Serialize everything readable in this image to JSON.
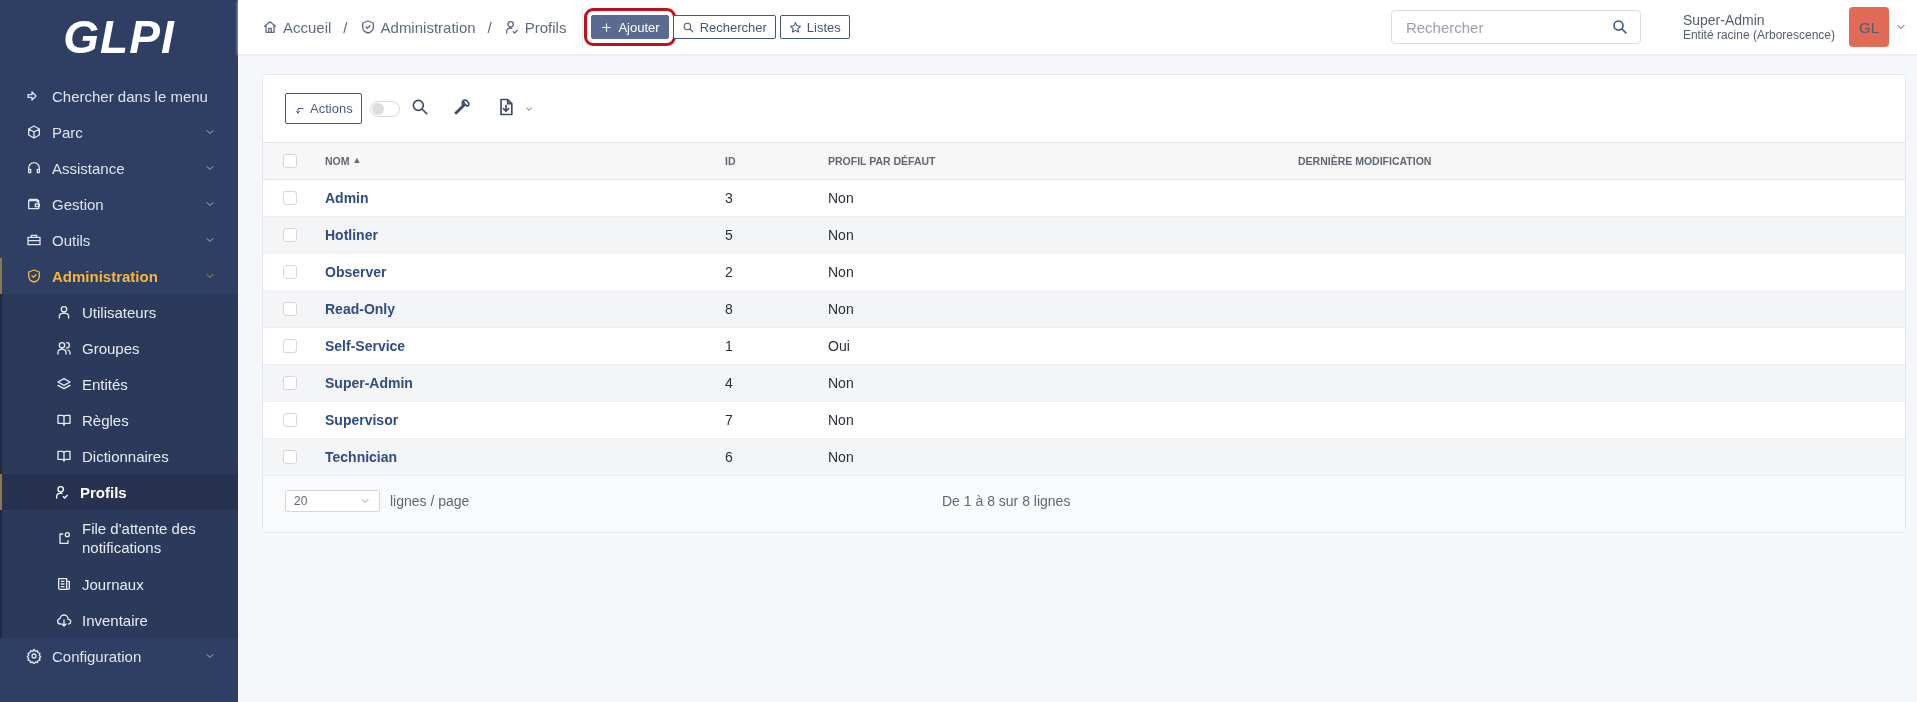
{
  "sidebar": {
    "logo": "GLPI",
    "search_item": "Chercher dans le menu",
    "items": [
      {
        "label": "Parc",
        "selected": false
      },
      {
        "label": "Assistance",
        "selected": false
      },
      {
        "label": "Gestion",
        "selected": false
      },
      {
        "label": "Outils",
        "selected": false
      },
      {
        "label": "Administration",
        "selected": true,
        "children": [
          {
            "label": "Utilisateurs",
            "selected": false
          },
          {
            "label": "Groupes",
            "selected": false
          },
          {
            "label": "Entités",
            "selected": false
          },
          {
            "label": "Règles",
            "selected": false
          },
          {
            "label": "Dictionnaires",
            "selected": false
          },
          {
            "label": "Profils",
            "selected": true
          },
          {
            "label": "File d'attente des notifications",
            "selected": false
          },
          {
            "label": "Journaux",
            "selected": false
          },
          {
            "label": "Inventaire",
            "selected": false
          }
        ]
      },
      {
        "label": "Configuration",
        "selected": false
      }
    ]
  },
  "header": {
    "breadcrumbs": [
      {
        "label": "Accueil"
      },
      {
        "label": "Administration"
      },
      {
        "label": "Profils"
      }
    ],
    "separator": "/",
    "buttons": [
      {
        "label": "Ajouter",
        "kind": "primary",
        "highlighted": true
      },
      {
        "label": "Rechercher",
        "kind": "outline",
        "highlighted": false
      },
      {
        "label": "Listes",
        "kind": "outline",
        "highlighted": false
      }
    ],
    "search": {
      "placeholder": "Rechercher"
    },
    "user": {
      "name": "Super-Admin",
      "entity": "Entité racine (Arborescence)",
      "initials": "GL"
    }
  },
  "toolbar": {
    "actions_label": "Actions",
    "toggle_on": false
  },
  "table": {
    "all_checked": false,
    "sort_mark": "▲",
    "columns": [
      {
        "label": "NOM",
        "sorted": true
      },
      {
        "label": "ID",
        "sorted": false
      },
      {
        "label": "PROFIL PAR DÉFAUT",
        "sorted": false
      },
      {
        "label": "DERNIÈRE MODIFICATION",
        "sorted": false
      }
    ],
    "rows": [
      {
        "name": "Admin",
        "id": "3",
        "default": "Non",
        "checked": false
      },
      {
        "name": "Hotliner",
        "id": "5",
        "default": "Non",
        "checked": false
      },
      {
        "name": "Observer",
        "id": "2",
        "default": "Non",
        "checked": false
      },
      {
        "name": "Read-Only",
        "id": "8",
        "default": "Non",
        "checked": false
      },
      {
        "name": "Self-Service",
        "id": "1",
        "default": "Oui",
        "checked": false
      },
      {
        "name": "Super-Admin",
        "id": "4",
        "default": "Non",
        "checked": false
      },
      {
        "name": "Supervisor",
        "id": "7",
        "default": "Non",
        "checked": false
      },
      {
        "name": "Technician",
        "id": "6",
        "default": "Non",
        "checked": false
      }
    ]
  },
  "footer": {
    "page_size": "20",
    "per_page_label": "lignes / page",
    "summary": "De 1 à 8 sur 8 lignes"
  }
}
